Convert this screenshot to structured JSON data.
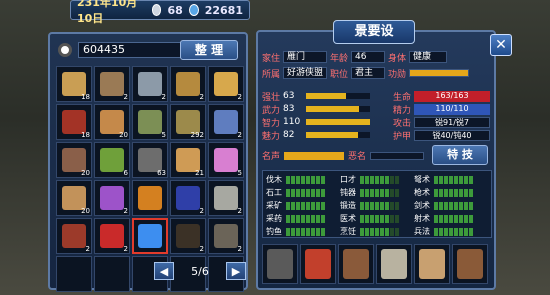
{
  "topbar": {
    "date": "231年10月10日",
    "silver": "68",
    "gold": "22681"
  },
  "inventory": {
    "money": "604435",
    "sort_label": "整 理",
    "page": "5/6",
    "cells": [
      {
        "color": "#c99e54",
        "qty": "18"
      },
      {
        "color": "#9a7a55",
        "qty": "2"
      },
      {
        "color": "#8c9aa8",
        "qty": "2"
      },
      {
        "color": "#b58a3e",
        "qty": "2"
      },
      {
        "color": "#d7a84c",
        "qty": "2"
      },
      {
        "color": "#a33326",
        "qty": "18"
      },
      {
        "color": "#c5894a",
        "qty": "20"
      },
      {
        "color": "#7c8f55",
        "qty": "5"
      },
      {
        "color": "#9c8a4b",
        "qty": "292"
      },
      {
        "color": "#5f7dbf",
        "qty": "2"
      },
      {
        "color": "#8a5f49",
        "qty": "20"
      },
      {
        "color": "#6fa03a",
        "qty": "6"
      },
      {
        "color": "#6d6d6d",
        "qty": "63"
      },
      {
        "color": "#cf9b55",
        "qty": "21"
      },
      {
        "color": "#d87fd1",
        "qty": "5"
      },
      {
        "color": "#c2925a",
        "qty": "20"
      },
      {
        "color": "#9d53c9",
        "qty": "2"
      },
      {
        "color": "#d48020",
        "qty": ""
      },
      {
        "color": "#2f3fa8",
        "qty": "2"
      },
      {
        "color": "#a7a8a1",
        "qty": "2"
      },
      {
        "color": "#9c3a2a",
        "qty": "2"
      },
      {
        "color": "#c92a2a",
        "qty": "2"
      },
      {
        "color": "#3d8ef0",
        "qty": "",
        "selected": true
      },
      {
        "color": "#3b3126",
        "qty": "2"
      },
      {
        "color": "#6b6458",
        "qty": "2"
      },
      {
        "color": "",
        "qty": ""
      },
      {
        "color": "",
        "qty": ""
      },
      {
        "color": "",
        "qty": ""
      },
      {
        "color": "",
        "qty": ""
      },
      {
        "color": "",
        "qty": ""
      }
    ]
  },
  "character": {
    "title": "景要设",
    "home_label": "家住",
    "home": "雁门",
    "age_label": "年龄",
    "age": "46",
    "body_label": "身体",
    "body": "健康",
    "faction_label": "所属",
    "faction": "好游侠盟",
    "rank_label": "职位",
    "rank": "君主",
    "kungfu_label": "功勋",
    "stats": [
      {
        "label": "强壮",
        "value": "63",
        "level": 0.63
      },
      {
        "label": "武力",
        "value": "83",
        "level": 0.83
      },
      {
        "label": "智力",
        "value": "110",
        "level": 1.0
      },
      {
        "label": "魅力",
        "value": "82",
        "level": 0.82
      }
    ],
    "vitals": [
      {
        "label": "生命",
        "value": "163/163",
        "kind": "hp"
      },
      {
        "label": "精力",
        "value": "110/110",
        "kind": "mp"
      },
      {
        "label": "攻击",
        "value": "锐91/锐7",
        "kind": "plain"
      },
      {
        "label": "护甲",
        "value": "锐40/钝40",
        "kind": "plain"
      }
    ],
    "fame_label": "名声",
    "evil_label": "恶名",
    "special_label": "特 技",
    "skills": [
      {
        "name": "伐木",
        "level": 8
      },
      {
        "name": "口才",
        "level": 6
      },
      {
        "name": "弩术",
        "level": 8
      },
      {
        "name": "石工",
        "level": 8
      },
      {
        "name": "钝器",
        "level": 6
      },
      {
        "name": "枪术",
        "level": 8
      },
      {
        "name": "采矿",
        "level": 8
      },
      {
        "name": "锻造",
        "level": 6
      },
      {
        "name": "剑术",
        "level": 8
      },
      {
        "name": "采药",
        "level": 8
      },
      {
        "name": "医术",
        "level": 6
      },
      {
        "name": "射术",
        "level": 8
      },
      {
        "name": "钓鱼",
        "level": 8
      },
      {
        "name": "烹饪",
        "level": 6
      },
      {
        "name": "兵法",
        "level": 8
      }
    ],
    "equipment": [
      {
        "color": "#5a5a5a"
      },
      {
        "color": "#c2402c"
      },
      {
        "color": "#8a5a3a"
      },
      {
        "color": "#b8b2a0"
      },
      {
        "color": "#c8a070"
      },
      {
        "color": "#8a5a38"
      }
    ]
  }
}
